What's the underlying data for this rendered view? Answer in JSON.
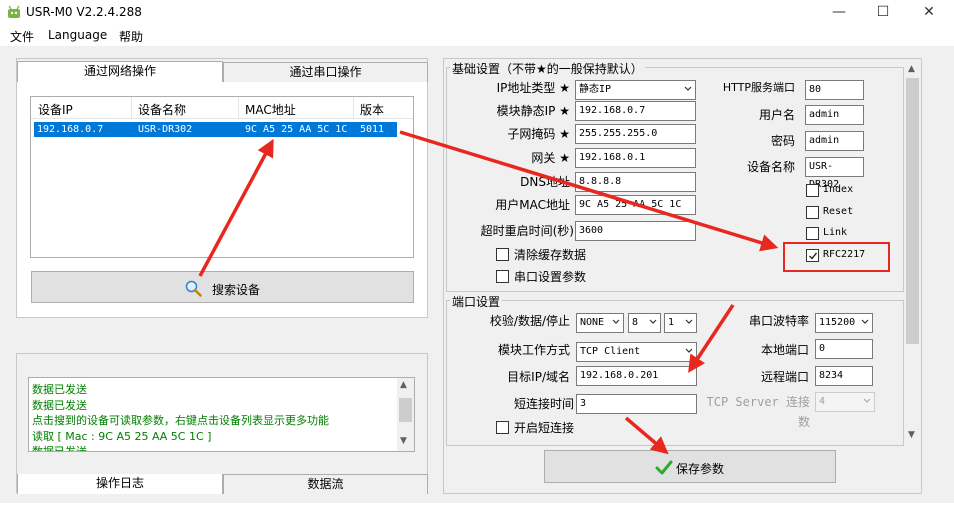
{
  "window": {
    "title": "USR-M0 V2.2.4.288",
    "minimize": "—",
    "maximize": "☐",
    "close": "✕"
  },
  "menu": [
    "文件",
    "Language",
    "帮助"
  ],
  "left": {
    "tabs": [
      "通过网络操作",
      "通过串口操作"
    ],
    "device_list": {
      "columns": [
        "设备IP",
        "设备名称",
        "MAC地址",
        "版本"
      ],
      "rows": [
        [
          "192.168.0.7",
          "USR-DR302",
          "9C A5 25 AA 5C 1C",
          "5011"
        ]
      ]
    },
    "search_button": "搜索设备",
    "log_lines": [
      "数据已发送",
      "数据已发送",
      "点击搜到的设备可读取参数，右键点击设备列表显示更多功能",
      "读取 [ Mac : 9C A5 25 AA 5C 1C ]",
      "数据已发送"
    ],
    "bottom_tabs": [
      "操作日志",
      "数据流"
    ]
  },
  "basic": {
    "title": "基础设置（不带★的一般保持默认）",
    "ip_type_label": "IP地址类型 ★",
    "ip_type_value": "静态IP",
    "static_ip_label": "模块静态IP ★",
    "static_ip_value": "192.168.0.7",
    "mask_label": "子网掩码 ★",
    "mask_value": "255.255.255.0",
    "gateway_label": "网关 ★",
    "gateway_value": "192.168.0.1",
    "dns_label": "DNS地址",
    "dns_value": "8.8.8.8",
    "mac_label": "用户MAC地址",
    "mac_value": "9C A5 25 AA 5C 1C",
    "timeout_label": "超时重启时间(秒)",
    "timeout_value": "3600",
    "clear_cache_label": "清除缓存数据",
    "serial_params_label": "串口设置参数",
    "http_port_label": "HTTP服务端口",
    "http_port_value": "80",
    "username_label": "用户名",
    "username_value": "admin",
    "password_label": "密码",
    "password_value": "admin",
    "device_name_label": "设备名称",
    "device_name_value": "USR-DR302",
    "index_label": "Index",
    "reset_label": "Reset",
    "link_label": "Link",
    "rfc_label": "RFC2217"
  },
  "port": {
    "title": "端口设置",
    "parity_label": "校验/数据/停止",
    "parity_value": "NONE",
    "data_bits": "8",
    "stop_bits": "1",
    "baud_label": "串口波特率",
    "baud_value": "115200",
    "mode_label": "模块工作方式",
    "mode_value": "TCP Client",
    "local_port_label": "本地端口",
    "local_port_value": "0",
    "target_label": "目标IP/域名",
    "target_value": "192.168.0.201",
    "remote_port_label": "远程端口",
    "remote_port_value": "8234",
    "short_conn_label": "短连接时间",
    "short_conn_value": "3",
    "tcp_server_label": "TCP Server 连接数",
    "tcp_server_value": "4",
    "enable_short_label": "开启短连接"
  },
  "save_button": "保存参数",
  "colors": {
    "selection": "#0078d7",
    "log_text": "#008000",
    "annotation": "#e8281e"
  }
}
